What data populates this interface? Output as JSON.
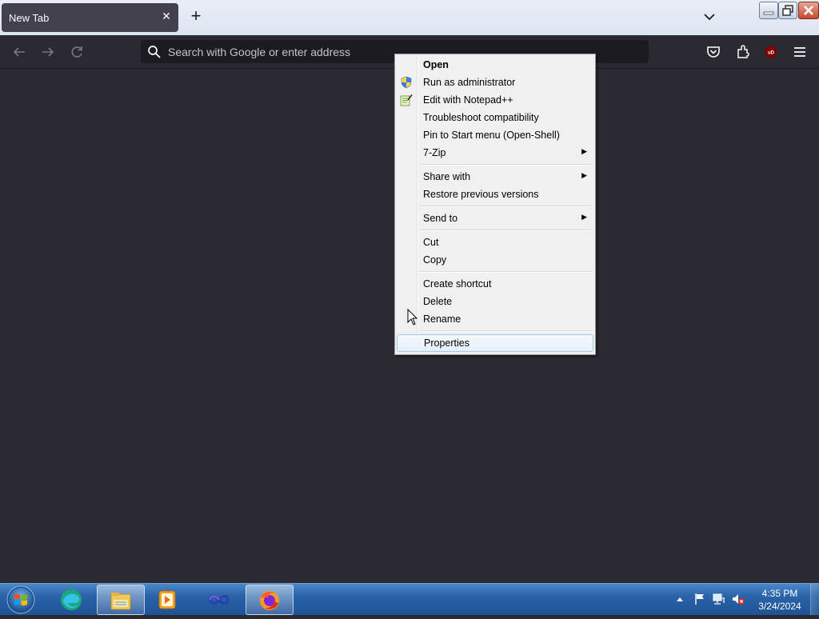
{
  "browser": {
    "tab_title": "New Tab",
    "url_placeholder": "Search with Google or enter address",
    "icons": [
      "back-icon",
      "forward-icon",
      "reload-icon",
      "pocket-icon",
      "extensions-icon",
      "ublock-icon",
      "menu-icon"
    ]
  },
  "context_menu": {
    "items": [
      {
        "label": "Open",
        "bold": true
      },
      {
        "label": "Run as administrator",
        "icon": "shield-icon"
      },
      {
        "label": "Edit with Notepad++",
        "icon": "notepad-plus-plus-icon"
      },
      {
        "label": "Troubleshoot compatibility"
      },
      {
        "label": "Pin to Start menu (Open-Shell)"
      },
      {
        "label": "7-Zip",
        "submenu": true
      },
      {
        "label": "Share with",
        "submenu": true
      },
      {
        "label": "Restore previous versions"
      },
      {
        "label": "Send to",
        "submenu": true
      },
      {
        "label": "Cut"
      },
      {
        "label": "Copy"
      },
      {
        "label": "Create shortcut"
      },
      {
        "label": "Delete"
      },
      {
        "label": "Rename"
      },
      {
        "label": "Properties",
        "highlighted": true
      }
    ],
    "submenu_arrow": "▶"
  },
  "taskbar": {
    "apps": [
      "edge-icon",
      "file-explorer-icon",
      "media-player-icon",
      "infinity-icon",
      "firefox-icon"
    ],
    "active_app": "firefox-icon",
    "clock_time": "4:35 PM",
    "clock_date": "3/24/2024"
  },
  "colors": {
    "browser_bg": "#2b2a33",
    "tab_bg": "#42414d",
    "menu_bg": "#f0f0f0",
    "taskbar": "#2a63a8"
  }
}
